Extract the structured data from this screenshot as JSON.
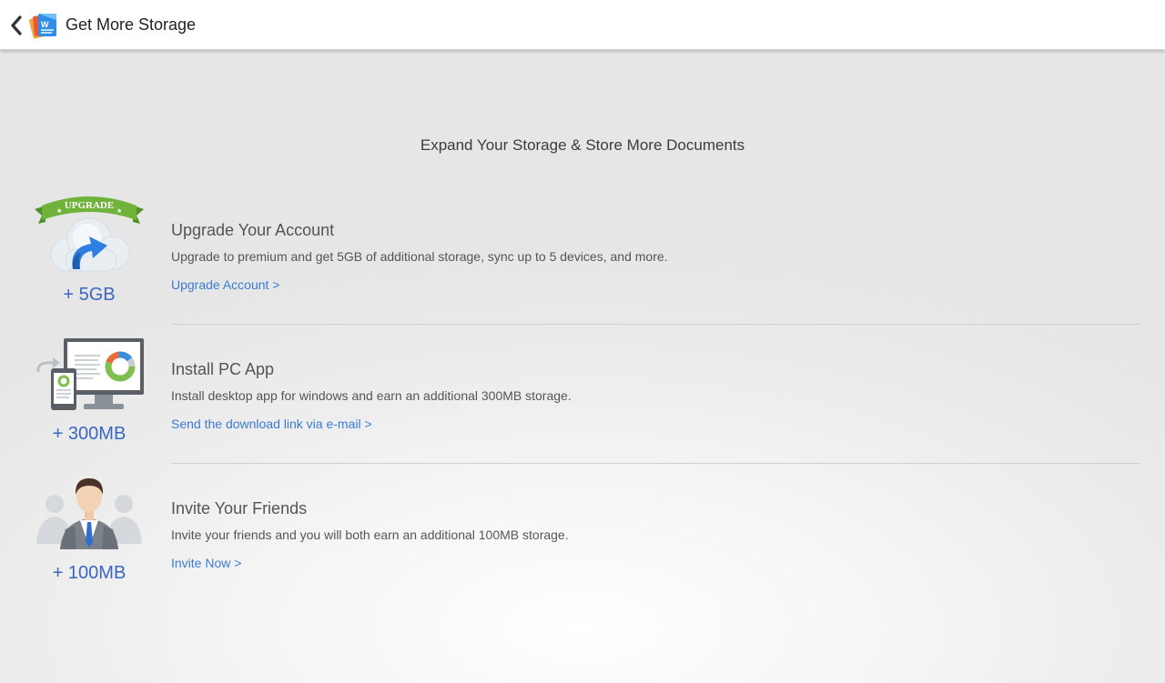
{
  "header": {
    "title": "Get More Storage",
    "back_icon": "chevron-left-icon",
    "logo_icon": "polaris-office-logo-icon"
  },
  "headline": "Expand Your Storage & Store More Documents",
  "sections": [
    {
      "icon": "upgrade-cloud-icon",
      "badge": "UPGRADE",
      "amount": "+ 5GB",
      "title": "Upgrade Your Account",
      "description": "Upgrade to premium and get 5GB of additional storage, sync up to 5 devices, and more.",
      "link": "Upgrade Account >"
    },
    {
      "icon": "pc-app-icon",
      "amount": "+ 300MB",
      "title": "Install PC App",
      "description": "Install desktop app for windows and earn an additional 300MB storage.",
      "link": "Send the download link via e-mail >"
    },
    {
      "icon": "invite-friends-icon",
      "amount": "+ 100MB",
      "title": "Invite Your Friends",
      "description": "Invite your friends and you will both earn an additional 100MB storage.",
      "link": "Invite Now >"
    }
  ],
  "colors": {
    "accent_link": "#3a7bd5",
    "amount": "#3a66c2",
    "upgrade_ribbon": "#6fb33b"
  }
}
